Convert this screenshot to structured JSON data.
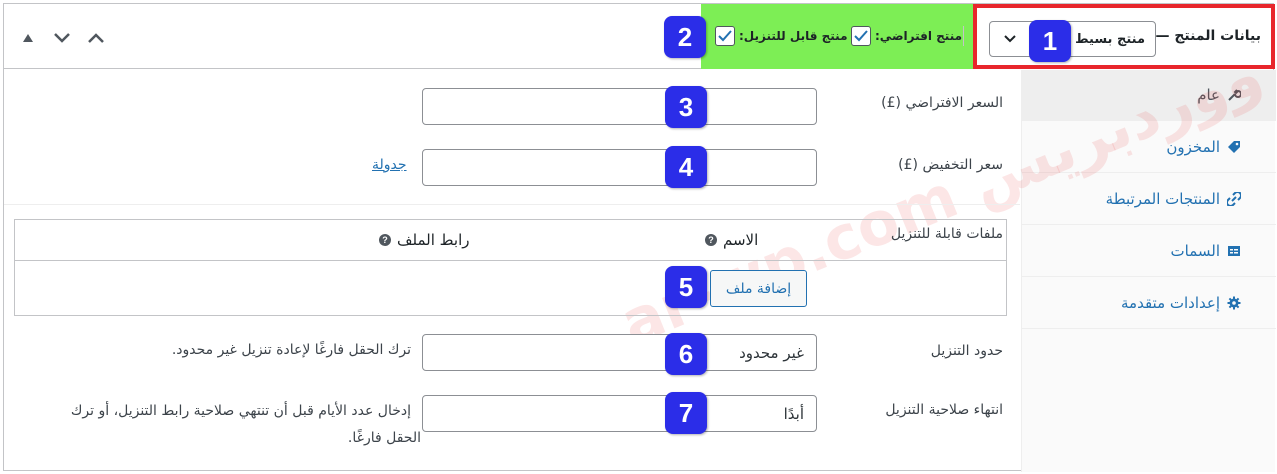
{
  "header": {
    "title": "بيانات المنتج —",
    "product_type": "منتج بسيط",
    "virtual_label": "منتج افتراضي:",
    "downloadable_label": "منتج قابل للتنزيل:",
    "virtual_checked": true,
    "downloadable_checked": true
  },
  "badges": [
    "1",
    "2",
    "3",
    "4",
    "5",
    "6",
    "7"
  ],
  "sidebar": {
    "items": [
      {
        "label": "عام",
        "icon": "wrench-icon"
      },
      {
        "label": "المخزون",
        "icon": "tag-icon"
      },
      {
        "label": "المنتجات المرتبطة",
        "icon": "link-icon"
      },
      {
        "label": "السمات",
        "icon": "table-icon"
      },
      {
        "label": "إعدادات متقدمة",
        "icon": "gear-icon"
      }
    ]
  },
  "fields": {
    "regular_price_label": "السعر الافتراضي (£)",
    "regular_price_value": "",
    "sale_price_label": "سعر التخفيض (£)",
    "sale_price_value": "",
    "schedule_link": "جدولة",
    "downloadable_files_label": "ملفات قابلة للتنزيل",
    "files_col_name": "الاسم",
    "files_col_url": "رابط الملف",
    "add_file_button": "إضافة ملف",
    "download_limit_label": "حدود التنزيل",
    "download_limit_value": "غير محدود",
    "download_limit_help": "ترك الحقل فارغًا لإعادة تنزيل غير محدود.",
    "download_expiry_label": "انتهاء صلاحية التنزيل",
    "download_expiry_value": "أبدًا",
    "download_expiry_help_1": "إدخال عدد الأيام قبل أن تنتهي صلاحية رابط التنزيل، أو ترك",
    "download_expiry_help_2": "الحقل فارغًا."
  },
  "watermark": "عرب ووردبريس ar-wp.com",
  "colors": {
    "highlight_green": "#7dee55",
    "highlight_red": "#e8262c",
    "badge_blue": "#2b2de8",
    "link_blue": "#2271b1"
  }
}
